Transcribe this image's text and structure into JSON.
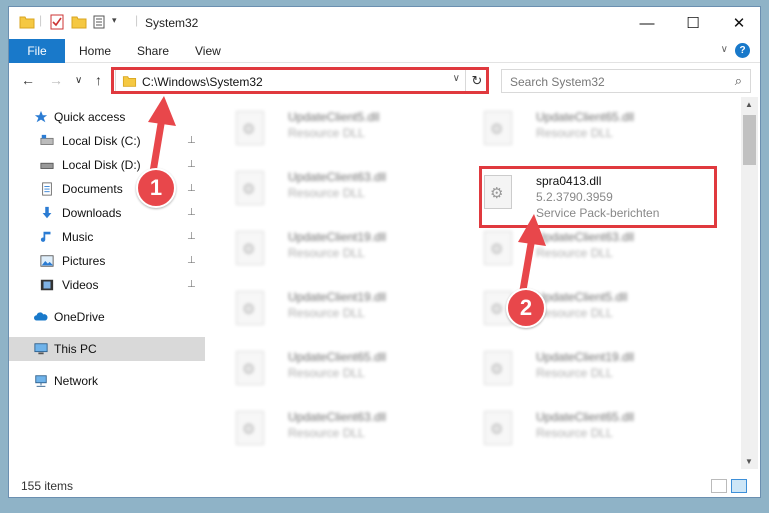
{
  "window": {
    "title": "System32",
    "minimize_glyph": "—",
    "maximize_glyph": "☐",
    "close_glyph": "✕"
  },
  "ribbon": {
    "tabs": [
      {
        "label": "File"
      },
      {
        "label": "Home"
      },
      {
        "label": "Share"
      },
      {
        "label": "View"
      }
    ],
    "expand_glyph": "∨",
    "help_glyph": "?"
  },
  "nav": {
    "back_glyph": "←",
    "forward_glyph": "→",
    "recent_glyph": "∨",
    "up_glyph": "↑",
    "address": "C:\\Windows\\System32",
    "address_dropdown_glyph": "∨",
    "refresh_glyph": "↻",
    "search_placeholder": "Search System32",
    "search_glyph": "⌕"
  },
  "sidebar": {
    "items": [
      {
        "label": "Quick access",
        "icon": "star-icon",
        "pinned": false
      },
      {
        "label": "Local Disk (C:)",
        "icon": "drive-icon",
        "pinned": true
      },
      {
        "label": "Local Disk (D:)",
        "icon": "drive-icon",
        "pinned": true
      },
      {
        "label": "Documents",
        "icon": "documents-icon",
        "pinned": true
      },
      {
        "label": "Downloads",
        "icon": "download-icon",
        "pinned": true
      },
      {
        "label": "Music",
        "icon": "music-icon",
        "pinned": true
      },
      {
        "label": "Pictures",
        "icon": "pictures-icon",
        "pinned": true
      },
      {
        "label": "Videos",
        "icon": "videos-icon",
        "pinned": true
      },
      {
        "label": "OneDrive",
        "icon": "cloud-icon",
        "pinned": false
      },
      {
        "label": "This PC",
        "icon": "computer-icon",
        "pinned": false,
        "selected": true
      },
      {
        "label": "Network",
        "icon": "network-icon",
        "pinned": false
      }
    ],
    "pin_glyph": "📌"
  },
  "files": {
    "left_column": [
      {
        "name": "UpdateClient5.dll",
        "type": "Resource DLL"
      },
      {
        "name": "UpdateClient63.dll",
        "type": "Resource DLL"
      },
      {
        "name": "UpdateClient19.dll",
        "type": "Resource DLL"
      },
      {
        "name": "UpdateClient19.dll",
        "type": "Resource DLL"
      },
      {
        "name": "UpdateClient65.dll",
        "type": "Resource DLL"
      },
      {
        "name": "UpdateClient63.dll",
        "type": "Resource DLL"
      }
    ],
    "right_column": [
      {
        "name": "UpdateClient65.dll",
        "type": "Resource DLL"
      },
      {
        "name": "spra0413.dll",
        "version": "5.2.3790.3959",
        "description": "Service Pack-berichten",
        "highlighted": true
      },
      {
        "name": "UpdateClient63.dll",
        "type": "Resource DLL"
      },
      {
        "name": "UpdateClient5.dll",
        "type": "Resource DLL"
      },
      {
        "name": "UpdateClient19.dll",
        "type": "Resource DLL"
      },
      {
        "name": "UpdateClient65.dll",
        "type": "Resource DLL"
      }
    ]
  },
  "status": {
    "item_count": "155 items"
  },
  "annotations": {
    "step1": "1",
    "step2": "2",
    "color": "#e8474b"
  },
  "colors": {
    "accent": "#1979ca",
    "highlight": "#e0393e"
  }
}
